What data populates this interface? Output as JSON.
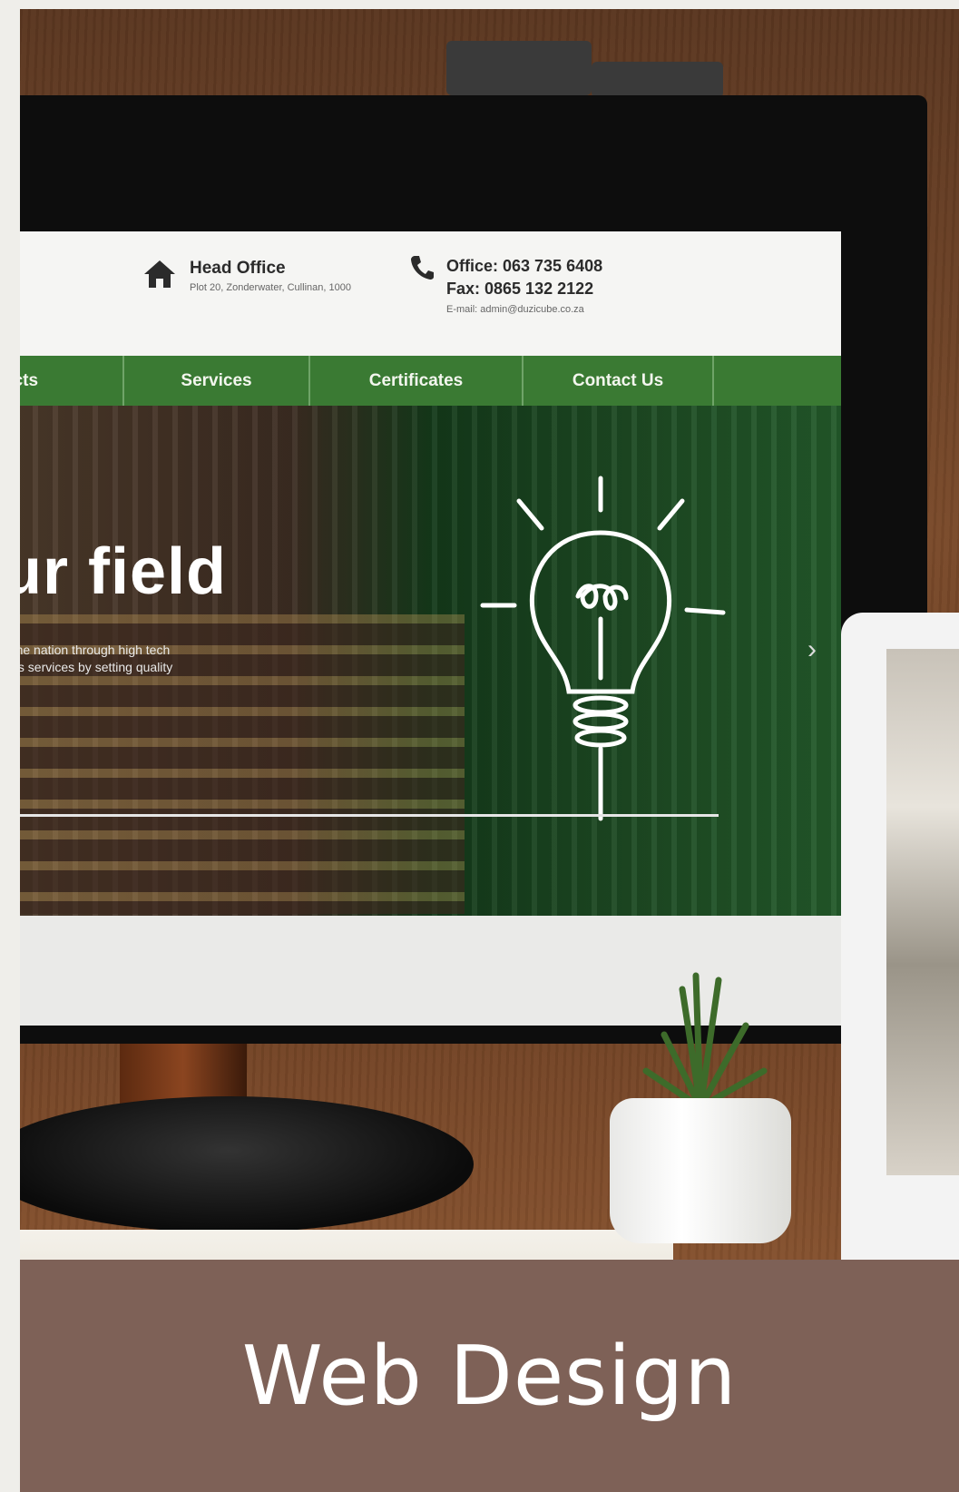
{
  "topbar": {
    "head_office": {
      "icon": "home-icon",
      "title": "Head Office",
      "address": "Plot 20, Zonderwater, Cullinan, 1000"
    },
    "contact": {
      "icon": "phone-icon",
      "office": "Office: 063 735 6408",
      "fax": "Fax: 0865 132 2122",
      "email": "E-mail: admin@duzicube.co.za"
    }
  },
  "nav": {
    "items": [
      {
        "label": "ects"
      },
      {
        "label": "Services"
      },
      {
        "label": "Certificates"
      },
      {
        "label": "Contact Us"
      }
    ]
  },
  "hero": {
    "title": "ur field",
    "subtitle_line1": "e the nation through high tech",
    "subtitle_line2": "lass services by setting quality",
    "next_arrow": "›"
  },
  "caption": {
    "text": "Web Design"
  },
  "colors": {
    "nav_green": "#3a7a33",
    "caption_brown": "#7e6157"
  }
}
